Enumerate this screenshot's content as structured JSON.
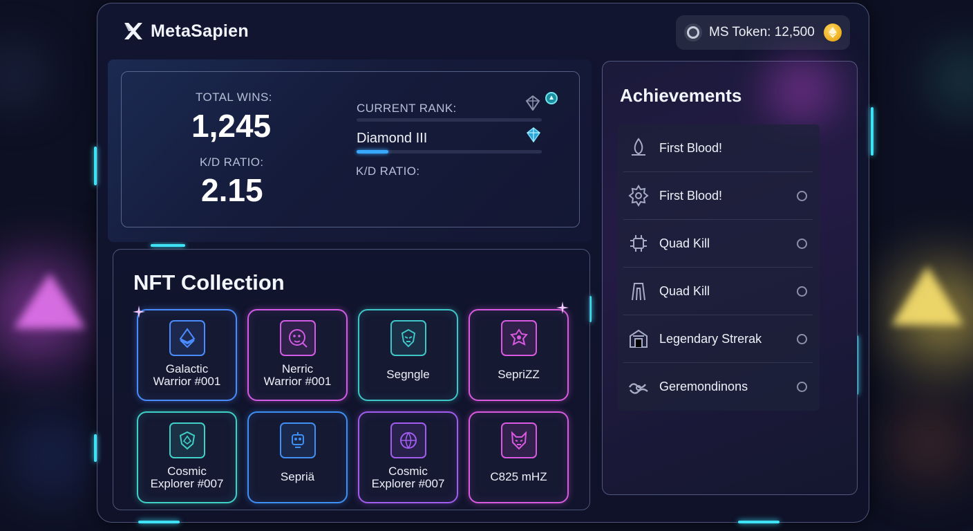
{
  "brand": {
    "name": "MetaSapien",
    "logo_icon": "x-logo-icon"
  },
  "token": {
    "label": "MS Token: 12,500",
    "icon": "token-ring-icon",
    "coin_icon": "ethereum-coin-icon",
    "coin_color": "#f2b414"
  },
  "stats": {
    "total_wins_label": "TOTAL WINS:",
    "total_wins_value": "1,245",
    "kd_label": "K/D RATIO:",
    "kd_value": "2.15",
    "current_rank_label": "CURRENT RANK:",
    "rank_name": "Diamond III",
    "rank_progress": 0.17,
    "kd_label_2": "K/D RATIO:"
  },
  "nft": {
    "title": "NFT Collection",
    "cards": [
      {
        "name": "Galactic\nWarrior #001",
        "color": "#4a8cff",
        "icon": "ethereum-icon"
      },
      {
        "name": "Nerric\nWarrior #001",
        "color": "#d35be6",
        "icon": "smiley-face-icon"
      },
      {
        "name": "Segngle",
        "color": "#3fc6c9",
        "icon": "warrior-helmet-icon"
      },
      {
        "name": "SepriZZ",
        "color": "#d95ae0",
        "icon": "emblem-icon"
      },
      {
        "name": "Cosmic\nExplorer #007",
        "color": "#3fd0c8",
        "icon": "shield-icon"
      },
      {
        "name": "Sepriä",
        "color": "#3f8ff5",
        "icon": "robot-icon"
      },
      {
        "name": "Cosmic\nExplorer #007",
        "color": "#a25cf0",
        "icon": "globe-icon"
      },
      {
        "name": "C825 mHZ",
        "color": "#d95ae0",
        "icon": "demon-mask-icon"
      }
    ]
  },
  "achievements": {
    "title": "Achievements",
    "items": [
      {
        "label": "First Blood!",
        "icon": "flame-icon",
        "has_radio": false
      },
      {
        "label": "First Blood!",
        "icon": "gear-badge-icon",
        "has_radio": true
      },
      {
        "label": "Quad Kill",
        "icon": "circuit-icon",
        "has_radio": true
      },
      {
        "label": "Quad Kill",
        "icon": "arch-icon",
        "has_radio": true
      },
      {
        "label": "Legendary Strerak",
        "icon": "building-icon",
        "has_radio": true
      },
      {
        "label": "Geremondinons",
        "icon": "hands-icon",
        "has_radio": true
      }
    ]
  },
  "colors": {
    "accent": "#3fe1f5",
    "rank_bar": "#39a9ff"
  }
}
